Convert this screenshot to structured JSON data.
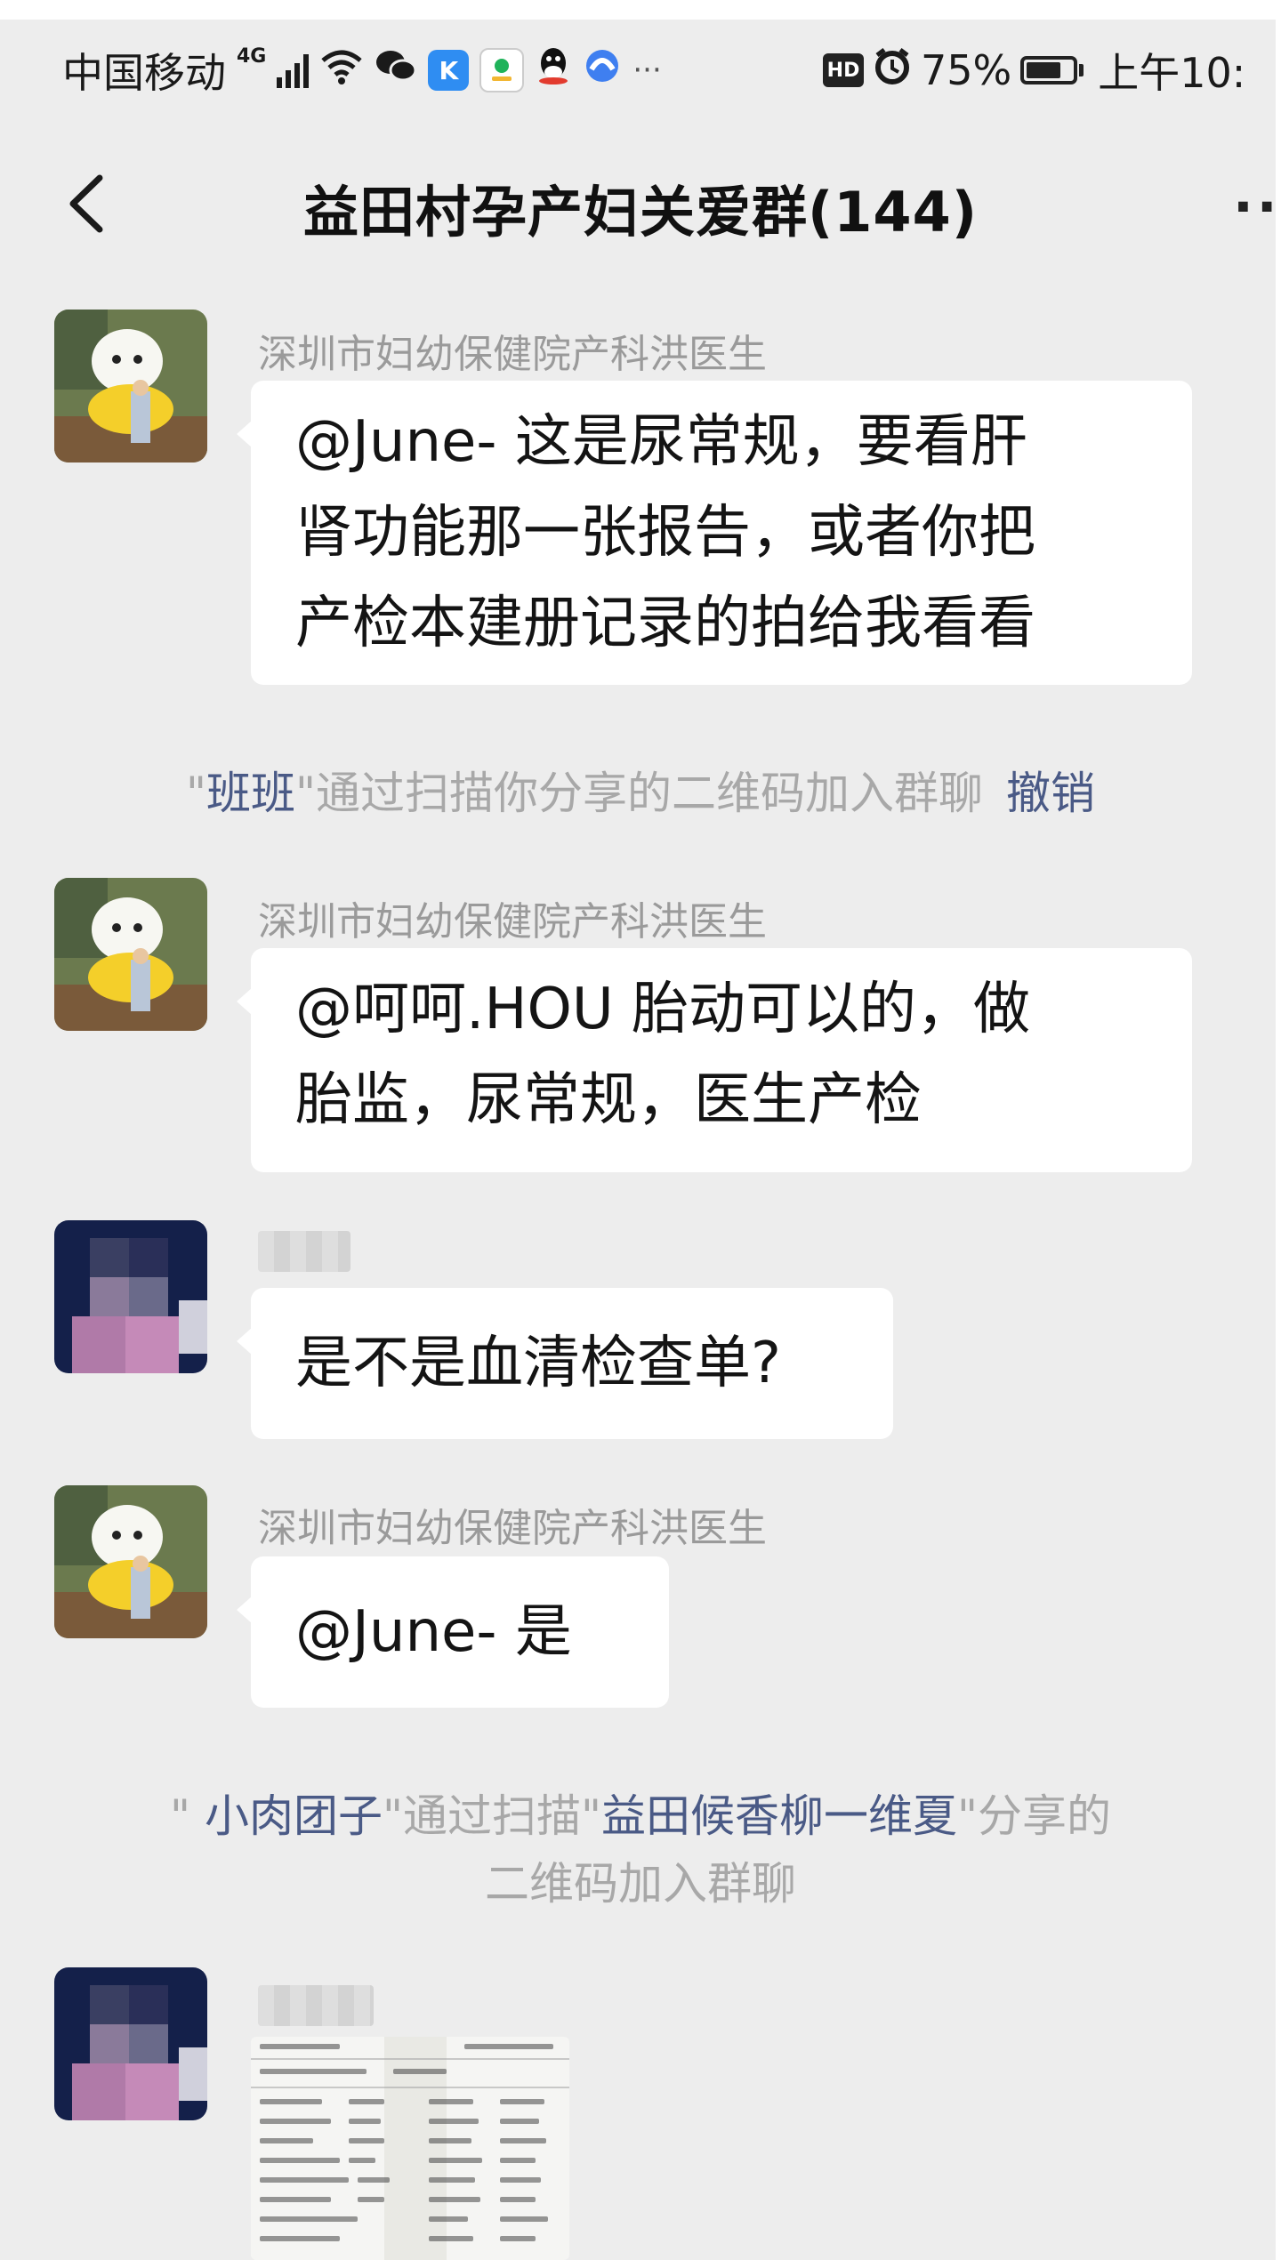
{
  "status_bar": {
    "carrier": "中国移动",
    "network_type": "4G",
    "app_icons": [
      "wifi-icon",
      "wechat-icon",
      "k-app-icon",
      "aiqiyi-icon",
      "qq-icon",
      "browser-icon"
    ],
    "overflow": "···",
    "hd_badge": "HD",
    "battery_percent": "75%",
    "battery_level": 0.75,
    "time": "上午10:"
  },
  "header": {
    "title": "益田村孕产妇关爱群(144)",
    "more": "··"
  },
  "messages": [
    {
      "type": "text",
      "sender": "深圳市妇幼保健院产科洪医生",
      "lines": [
        "@June- 这是尿常规，要看肝",
        "肾功能那一张报告，或者你把",
        "产检本建册记录的拍给我看看"
      ]
    },
    {
      "type": "system",
      "quote_open": "\"",
      "name": "班班",
      "quote_close": "\"",
      "text": "通过扫描你分享的二维码加入群聊",
      "action": "撤销"
    },
    {
      "type": "text",
      "sender": "深圳市妇幼保健院产科洪医生",
      "lines": [
        "@呵呵.HOU 胎动可以的，做",
        "胎监，尿常规，医生产检"
      ]
    },
    {
      "type": "text",
      "sender": "",
      "lines": [
        "是不是血清检查单?"
      ]
    },
    {
      "type": "text",
      "sender": "深圳市妇幼保健院产科洪医生",
      "lines": [
        "@June- 是"
      ]
    },
    {
      "type": "system",
      "quote_open": "\" ",
      "name": "小肉团子",
      "middle": "\"通过扫描\"",
      "inviter": "益田候香柳一维夏",
      "text_end": "\"分享的",
      "line2": "二维码加入群聊"
    },
    {
      "type": "image",
      "sender": ""
    }
  ],
  "colors": {
    "background": "#ededed",
    "bubble": "#ffffff",
    "link": "#4a5a86",
    "system_text": "#a8a8a8",
    "sender_text": "#9a9a9a"
  }
}
